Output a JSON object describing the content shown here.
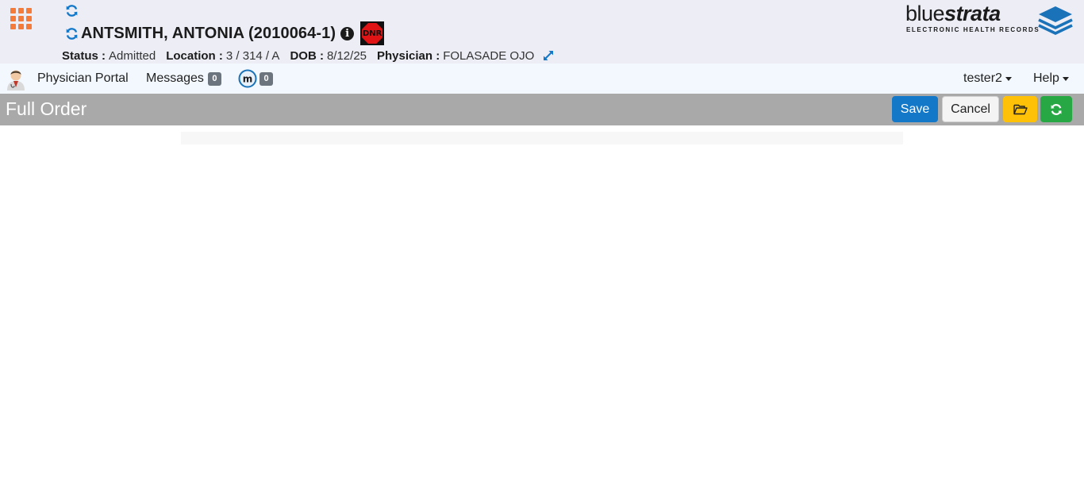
{
  "header": {
    "patient_name": "ANTSMITH, ANTONIA (2010064-1)",
    "dnr_label": "DNR",
    "status_label": "Status :",
    "status_value": "Admitted",
    "location_label": "Location :",
    "location_value": "3 / 314 / A",
    "dob_label": "DOB :",
    "dob_value": "8/12/25",
    "physician_label": "Physician :",
    "physician_value": "FOLASADE OJO",
    "icons": [
      "app-grid-icon",
      "refresh-icon",
      "info-icon",
      "dnr-icon",
      "expand-icon"
    ],
    "colors": {
      "background": "#ecedf5",
      "app_grid": "#f47b3a",
      "refresh": "#1478c8",
      "dnr": "#e01414"
    }
  },
  "logo": {
    "word_blue": "blue",
    "word_strata": "strata",
    "subtitle": "ELECTRONIC HEALTH RECORDS",
    "accent": "#1a72b8"
  },
  "nav": {
    "portal_label": "Physician Portal",
    "messages_label": "Messages",
    "messages_count": "0",
    "m_count": "0",
    "user_label": "tester2",
    "help_label": "Help",
    "background": "#f2f8fd"
  },
  "toolbar": {
    "title": "Full Order",
    "save_label": "Save",
    "cancel_label": "Cancel",
    "colors": {
      "bar": "#a9a9a9",
      "save": "#1478c8",
      "open": "#ffc107",
      "reload": "#28a745"
    }
  }
}
